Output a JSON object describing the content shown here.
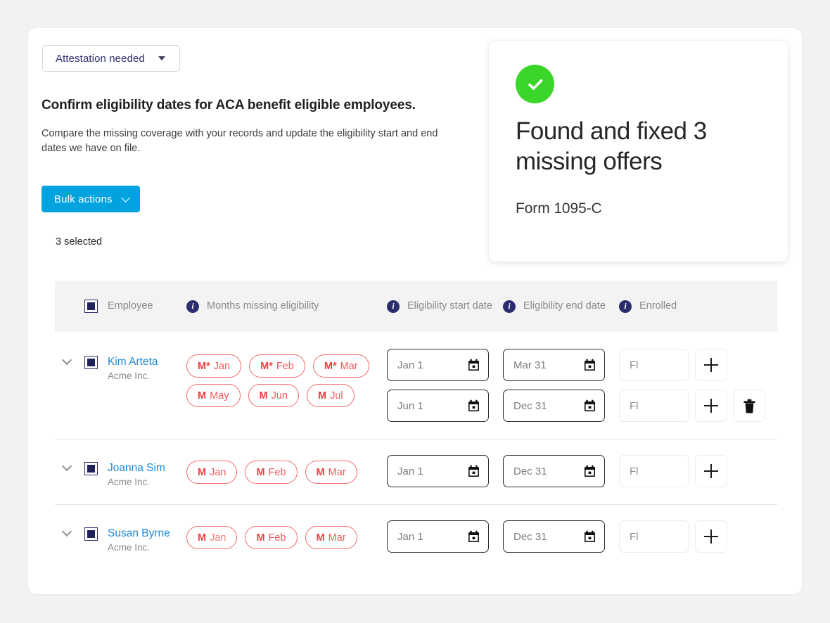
{
  "filter": {
    "label": "Attestation needed",
    "caret_icon": "caret-down-icon"
  },
  "header": {
    "title": "Confirm eligibility dates for ACA benefit eligible employees.",
    "subtitle": "Compare the missing coverage with your records and update the eligibility start and end dates we have on file."
  },
  "bulk_actions": {
    "label": "Bulk actions",
    "chevron_icon": "chevron-down-icon",
    "accent_color": "#00a3e0"
  },
  "selection": {
    "count_label": "3 selected"
  },
  "callout": {
    "icon": "check-circle-icon",
    "icon_color": "#3ad62a",
    "title": "Found and fixed 3 missing offers",
    "subtitle": "Form 1095-C"
  },
  "table": {
    "columns": {
      "employee": "Employee",
      "months": "Months missing eligibility",
      "start_date": "Eligibility start date",
      "end_date": "Eligibility end date",
      "enrolled": "Enrolled"
    },
    "info_icon": "info-icon",
    "select_all_state": "indeterminate",
    "rows": [
      {
        "name": "Kim Arteta",
        "org": "Acme Inc.",
        "selected": true,
        "expand_icon": "chevron-down-icon",
        "chips": [
          {
            "code": "M*",
            "month": "Jan",
            "soft": false
          },
          {
            "code": "M*",
            "month": "Feb",
            "soft": false
          },
          {
            "code": "M*",
            "month": "Mar",
            "soft": false
          },
          {
            "code": "M",
            "month": "May",
            "soft": false
          },
          {
            "code": "M",
            "month": "Jun",
            "soft": false
          },
          {
            "code": "M",
            "month": "Jul",
            "soft": false
          }
        ],
        "periods": [
          {
            "start": "Jan 1",
            "end": "Mar 31",
            "enrolled": "Fl",
            "has_delete": false
          },
          {
            "start": "Jun 1",
            "end": "Dec 31",
            "enrolled": "Fl",
            "has_delete": true
          }
        ]
      },
      {
        "name": "Joanna Sim",
        "org": "Acme Inc.",
        "selected": true,
        "expand_icon": "chevron-down-icon",
        "chips": [
          {
            "code": "M",
            "month": "Jan",
            "soft": false
          },
          {
            "code": "M",
            "month": "Feb",
            "soft": false
          },
          {
            "code": "M",
            "month": "Mar",
            "soft": false
          }
        ],
        "periods": [
          {
            "start": "Jan 1",
            "end": "Dec 31",
            "enrolled": "Fl",
            "has_delete": false
          }
        ]
      },
      {
        "name": "Susan Byrne",
        "org": "Acme Inc.",
        "selected": true,
        "expand_icon": "chevron-down-icon",
        "chips": [
          {
            "code": "M",
            "month": "Jan",
            "soft": true
          },
          {
            "code": "M",
            "month": "Feb",
            "soft": false
          },
          {
            "code": "M",
            "month": "Mar",
            "soft": false
          }
        ],
        "periods": [
          {
            "start": "Jan 1",
            "end": "Dec 31",
            "enrolled": "Fl",
            "has_delete": false
          }
        ]
      }
    ],
    "buttons": {
      "add_icon": "plus-icon",
      "delete_icon": "trash-icon",
      "calendar_icon": "calendar-icon"
    }
  }
}
